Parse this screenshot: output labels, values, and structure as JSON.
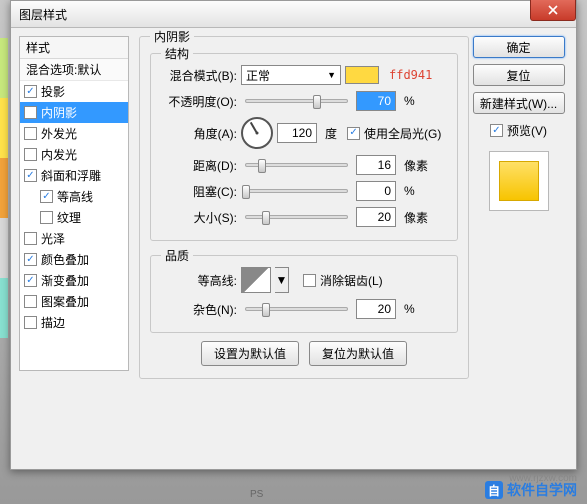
{
  "dialog": {
    "title": "图层样式"
  },
  "sidebar": {
    "header": "样式",
    "sub": "混合选项:默认",
    "items": [
      {
        "label": "投影",
        "checked": true,
        "active": false,
        "indent": false
      },
      {
        "label": "内阴影",
        "checked": true,
        "active": true,
        "indent": false
      },
      {
        "label": "外发光",
        "checked": false,
        "active": false,
        "indent": false
      },
      {
        "label": "内发光",
        "checked": false,
        "active": false,
        "indent": false
      },
      {
        "label": "斜面和浮雕",
        "checked": true,
        "active": false,
        "indent": false
      },
      {
        "label": "等高线",
        "checked": true,
        "active": false,
        "indent": true
      },
      {
        "label": "纹理",
        "checked": false,
        "active": false,
        "indent": true
      },
      {
        "label": "光泽",
        "checked": false,
        "active": false,
        "indent": false
      },
      {
        "label": "颜色叠加",
        "checked": true,
        "active": false,
        "indent": false
      },
      {
        "label": "渐变叠加",
        "checked": true,
        "active": false,
        "indent": false
      },
      {
        "label": "图案叠加",
        "checked": false,
        "active": false,
        "indent": false
      },
      {
        "label": "描边",
        "checked": false,
        "active": false,
        "indent": false
      }
    ]
  },
  "main": {
    "title": "内阴影",
    "struct": {
      "title": "结构",
      "blend": {
        "label": "混合模式(B):",
        "value": "正常",
        "hex": "ffd941",
        "swatch": "#ffd941"
      },
      "opacity": {
        "label": "不透明度(O):",
        "value": "70",
        "pct": 70,
        "unit": "%"
      },
      "angle": {
        "label": "角度(A):",
        "value": "120",
        "unit": "度",
        "global_label": "使用全局光(G)",
        "global": true
      },
      "distance": {
        "label": "距离(D):",
        "value": "16",
        "pct": 16,
        "unit": "像素"
      },
      "choke": {
        "label": "阻塞(C):",
        "value": "0",
        "pct": 0,
        "unit": "%"
      },
      "size": {
        "label": "大小(S):",
        "value": "20",
        "pct": 20,
        "unit": "像素"
      }
    },
    "quality": {
      "title": "品质",
      "contour": {
        "label": "等高线:",
        "anti_label": "消除锯齿(L)",
        "anti": false
      },
      "noise": {
        "label": "杂色(N):",
        "value": "20",
        "pct": 20,
        "unit": "%"
      }
    },
    "buttons": {
      "default": "设置为默认值",
      "reset": "复位为默认值"
    }
  },
  "right": {
    "ok": "确定",
    "cancel": "复位",
    "newstyle": "新建样式(W)...",
    "preview_label": "预览(V)",
    "preview_checked": true
  },
  "footer": {
    "ps": "PS",
    "wm_url": "www.rjzxw.com",
    "wm_txt": "软件自学网",
    "wm_badge": "自"
  }
}
